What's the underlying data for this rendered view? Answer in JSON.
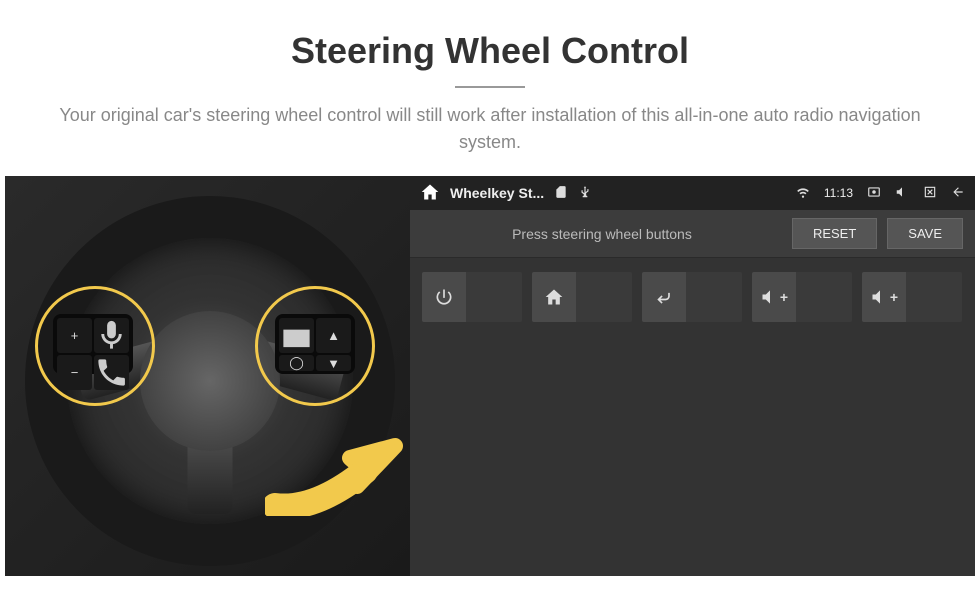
{
  "header": {
    "title": "Steering Wheel Control",
    "subtitle": "Your original car's steering wheel control will still work after installation of this all-in-one auto radio navigation system."
  },
  "wheel": {
    "left_buttons": [
      "+",
      "voice",
      "−",
      "phone"
    ],
    "right_buttons": [
      "radio",
      "nav-up",
      "cycle",
      "nav-down"
    ]
  },
  "status_bar": {
    "app_title": "Wheelkey St...",
    "time": "11:13"
  },
  "toolbar": {
    "prompt": "Press steering wheel buttons",
    "reset_label": "RESET",
    "save_label": "SAVE"
  },
  "grid": {
    "cells": [
      {
        "icon": "power",
        "label": ""
      },
      {
        "icon": "home",
        "label": ""
      },
      {
        "icon": "back",
        "label": ""
      },
      {
        "icon": "vol-up",
        "label": ""
      },
      {
        "icon": "vol-up",
        "label": ""
      }
    ]
  }
}
